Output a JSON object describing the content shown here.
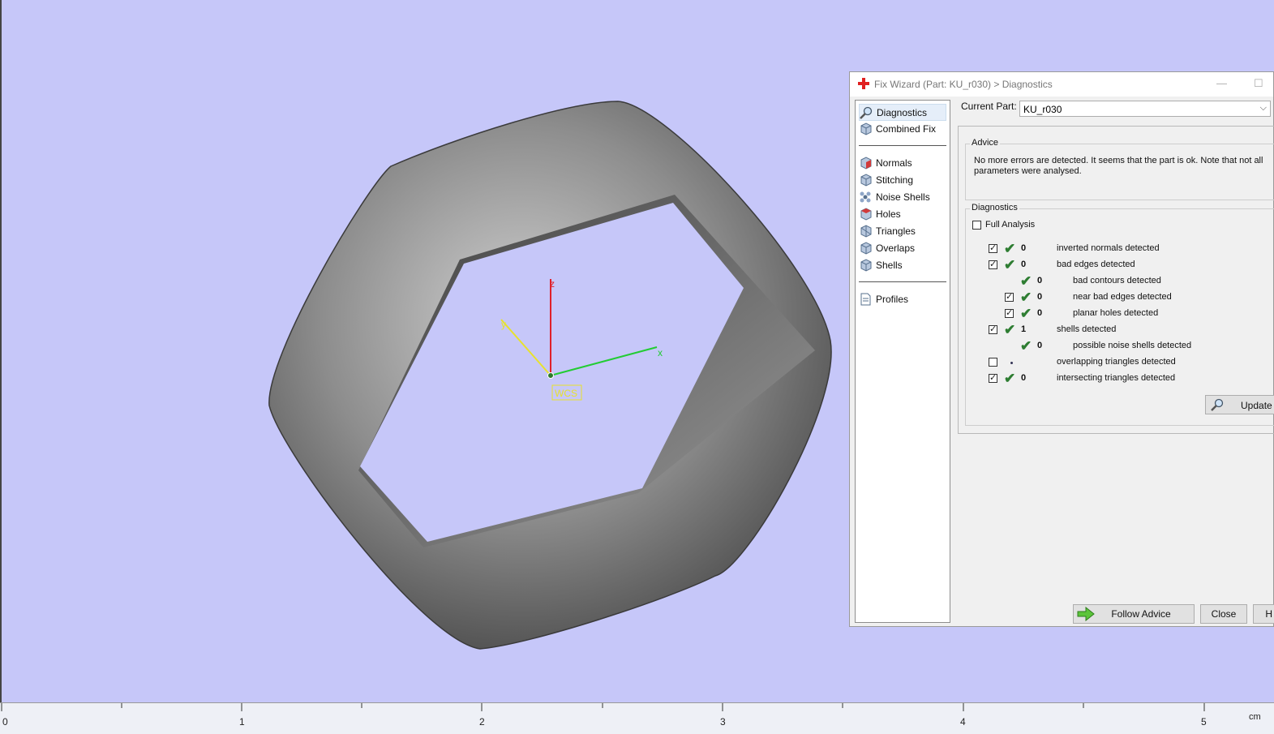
{
  "dialog": {
    "title": "Fix Wizard (Part: KU_r030) > Diagnostics",
    "minimize_glyph": "—",
    "maximize_glyph": "☐"
  },
  "nav": {
    "top": [
      {
        "label": "Diagnostics",
        "icon": "magnifier-icon"
      },
      {
        "label": "Combined Fix",
        "icon": "cube-icon"
      }
    ],
    "tools": [
      {
        "label": "Normals",
        "icon": "normals-cube-icon"
      },
      {
        "label": "Stitching",
        "icon": "stitching-cube-icon"
      },
      {
        "label": "Noise Shells",
        "icon": "noise-shells-icon"
      },
      {
        "label": "Holes",
        "icon": "holes-cube-icon"
      },
      {
        "label": "Triangles",
        "icon": "triangles-cube-icon"
      },
      {
        "label": "Overlaps",
        "icon": "overlaps-cube-icon"
      },
      {
        "label": "Shells",
        "icon": "shells-cube-icon"
      }
    ],
    "profiles": {
      "label": "Profiles",
      "icon": "profile-document-icon"
    }
  },
  "current_part": {
    "label": "Current Part:",
    "value": "KU_r030"
  },
  "advice": {
    "title": "Advice",
    "text": "No more errors are detected. It seems that the part is ok. Note that not all parameters were analysed."
  },
  "diagnostics": {
    "title": "Diagnostics",
    "full_analysis_label": "Full Analysis",
    "rows": [
      {
        "checkbox": true,
        "checked": true,
        "ok": true,
        "value": "0",
        "label": "inverted normals detected",
        "indent": 0
      },
      {
        "checkbox": true,
        "checked": true,
        "ok": true,
        "value": "0",
        "label": "bad edges detected",
        "indent": 0
      },
      {
        "checkbox": false,
        "checked": false,
        "ok": true,
        "value": "0",
        "label": "bad contours detected",
        "indent": 1
      },
      {
        "checkbox": true,
        "checked": true,
        "ok": true,
        "value": "0",
        "label": "near bad edges detected",
        "indent": 1
      },
      {
        "checkbox": true,
        "checked": true,
        "ok": true,
        "value": "0",
        "label": "planar holes detected",
        "indent": 1
      },
      {
        "checkbox": true,
        "checked": true,
        "ok": true,
        "value": "1",
        "label": "shells detected",
        "indent": 0
      },
      {
        "checkbox": false,
        "checked": false,
        "ok": true,
        "value": "0",
        "label": "possible noise shells detected",
        "indent": 1
      },
      {
        "checkbox": true,
        "checked": false,
        "ok": false,
        "value": "",
        "label": "overlapping triangles detected",
        "indent": 0
      },
      {
        "checkbox": true,
        "checked": true,
        "ok": true,
        "value": "0",
        "label": "intersecting triangles detected",
        "indent": 0
      }
    ]
  },
  "buttons": {
    "update": "Update",
    "follow_advice": "Follow Advice",
    "close": "Close",
    "help": "H"
  },
  "viewport": {
    "axis_z": "z",
    "axis_x": "x",
    "axis_y": "y",
    "wcs_label": "WCS",
    "background": "#c6c7f9"
  },
  "ruler": {
    "labels": [
      "0",
      "1",
      "2",
      "3",
      "4",
      "5"
    ],
    "unit": "cm"
  }
}
